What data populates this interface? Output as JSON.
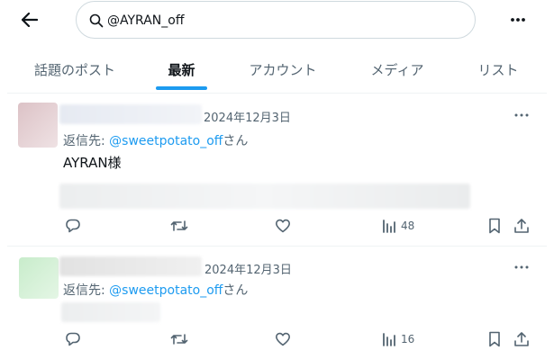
{
  "search": {
    "value": "@AYRAN_off"
  },
  "tabs": [
    {
      "label": "話題のポスト",
      "active": false
    },
    {
      "label": "最新",
      "active": true
    },
    {
      "label": "アカウント",
      "active": false
    },
    {
      "label": "メディア",
      "active": false
    },
    {
      "label": "リスト",
      "active": false
    }
  ],
  "colors": {
    "accent": "#1d9bf0",
    "secondary_text": "#536471",
    "divider": "#eff3f4"
  },
  "tweets": [
    {
      "date": "2024年12月3日",
      "reply_prefix": "返信先: ",
      "reply_to": "@sweetpotato_off",
      "reply_suffix": "さん",
      "text": "AYRAN様",
      "views": "48"
    },
    {
      "date": "2024年12月3日",
      "reply_prefix": "返信先: ",
      "reply_to": "@sweetpotato_off",
      "reply_suffix": "さん",
      "text": "",
      "views": "16"
    }
  ],
  "icons": [
    "back-arrow-icon",
    "search-icon",
    "more-icon",
    "reply-icon",
    "retweet-icon",
    "like-icon",
    "views-icon",
    "bookmark-icon",
    "share-icon"
  ]
}
